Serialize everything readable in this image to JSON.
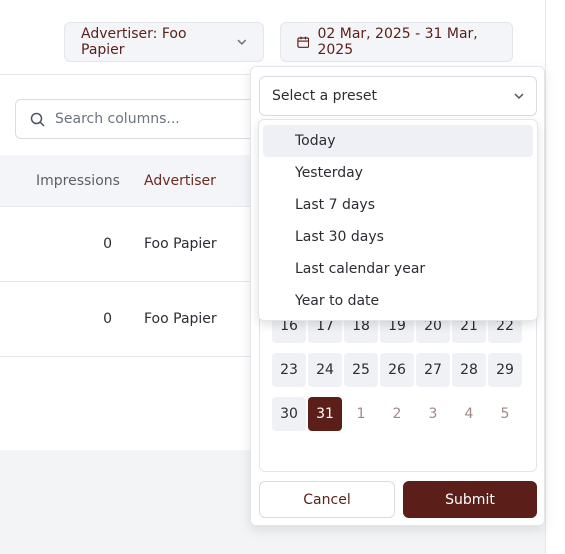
{
  "toolbar": {
    "advertiser_label": "Advertiser: Foo Papier",
    "date_range_label": "02 Mar, 2025 - 31 Mar, 2025"
  },
  "search": {
    "placeholder": "Search columns..."
  },
  "table": {
    "columns": [
      "Impressions",
      "Advertiser"
    ],
    "rows": [
      {
        "impressions": "0",
        "advertiser": "Foo Papier"
      },
      {
        "impressions": "0",
        "advertiser": "Foo Papier"
      }
    ]
  },
  "date_picker": {
    "preset_placeholder": "Select a preset",
    "presets": [
      "Today",
      "Yesterday",
      "Last 7 days",
      "Last 30 days",
      "Last calendar year",
      "Year to date"
    ],
    "highlighted_preset": "Today",
    "calendar_rows": [
      [
        "16",
        "17",
        "18",
        "19",
        "20",
        "21",
        "22"
      ],
      [
        "23",
        "24",
        "25",
        "26",
        "27",
        "28",
        "29"
      ],
      [
        "30",
        "31",
        "1",
        "2",
        "3",
        "4",
        "5"
      ]
    ],
    "selected_day": "31",
    "cancel_label": "Cancel",
    "submit_label": "Submit"
  },
  "colors": {
    "brand": "#5b1e18",
    "muted_day": "#f0f1f5"
  },
  "icons": [
    "chevron-down-icon",
    "calendar-icon",
    "search-icon"
  ]
}
